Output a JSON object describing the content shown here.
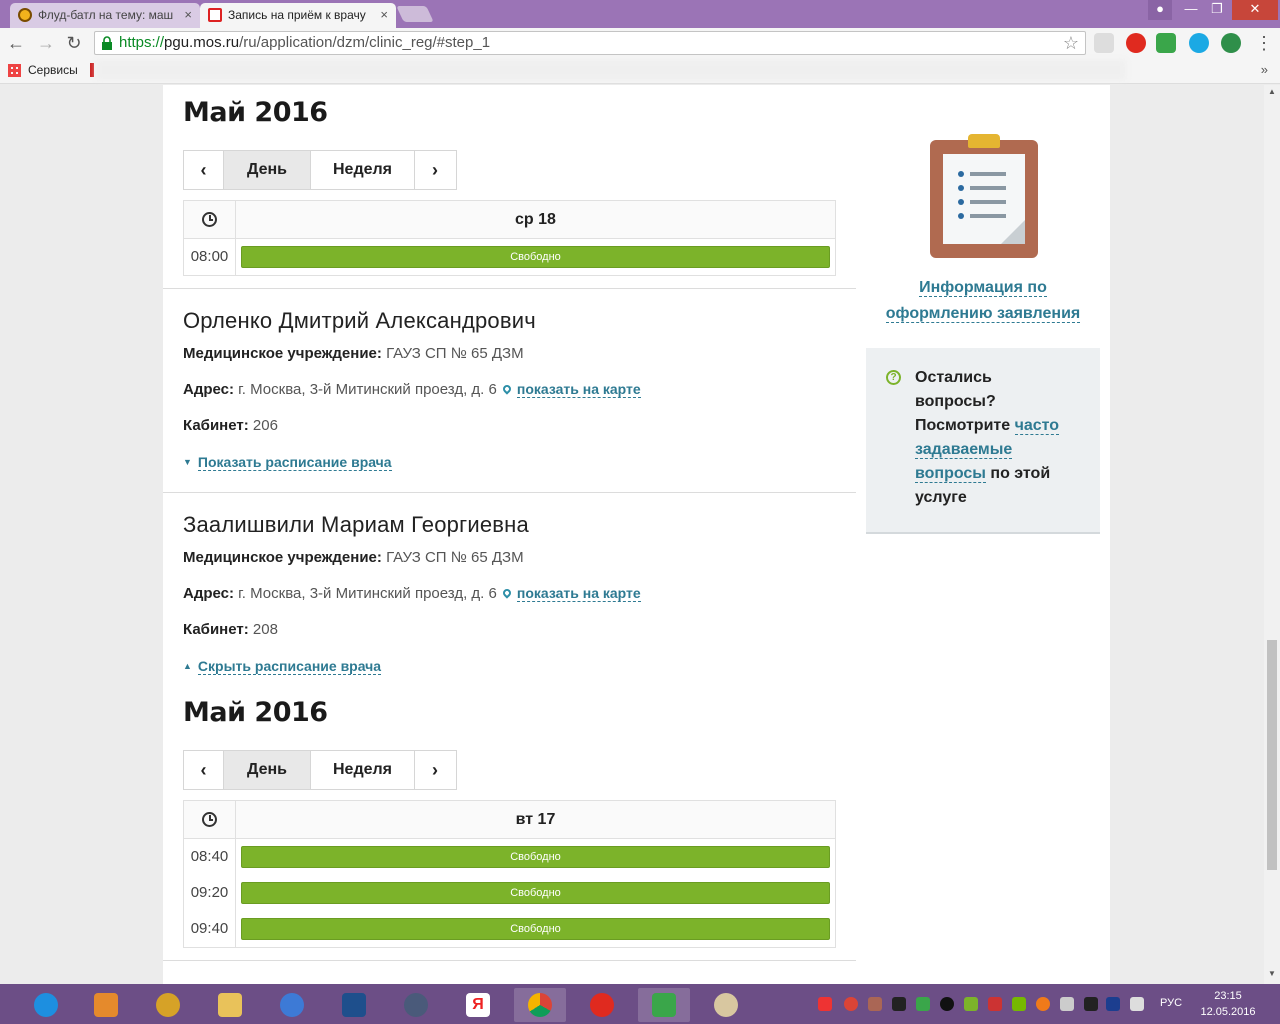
{
  "browser": {
    "tabs": [
      {
        "title": "Флуд-батл на тему: маш",
        "active": false
      },
      {
        "title": "Запись на приём к врачу",
        "active": true
      }
    ],
    "url_scheme": "https://",
    "url_host": "pgu.mos.ru",
    "url_path": "/ru/application/dzm/clinic_reg/#step_1",
    "bookmarks_label": "Сервисы",
    "bookmarks_more": "»"
  },
  "schedule_top": {
    "month": "Май 2016",
    "view_day": "День",
    "view_week": "Неделя",
    "day_header": "ср 18",
    "slots": [
      {
        "time": "08:00",
        "status": "Свободно"
      }
    ]
  },
  "doctors": [
    {
      "name": "Орленко Дмитрий Александрович",
      "institution_label": "Медицинское учреждение:",
      "institution": "ГАУЗ СП № 65 ДЗМ",
      "address_label": "Адрес:",
      "address": "г. Москва, 3-й Митинский проезд, д. 6",
      "map_link": "показать на карте",
      "room_label": "Кабинет:",
      "room": "206",
      "toggle_label": "Показать расписание врача"
    },
    {
      "name": "Заалишвили Мариам Георгиевна",
      "institution_label": "Медицинское учреждение:",
      "institution": "ГАУЗ СП № 65 ДЗМ",
      "address_label": "Адрес:",
      "address": "г. Москва, 3-й Митинский проезд, д. 6",
      "map_link": "показать на карте",
      "room_label": "Кабинет:",
      "room": "208",
      "toggle_label": "Скрыть расписание врача"
    }
  ],
  "schedule_bottom": {
    "month": "Май 2016",
    "view_day": "День",
    "view_week": "Неделя",
    "day_header": "вт 17",
    "slots": [
      {
        "time": "08:40",
        "status": "Свободно"
      },
      {
        "time": "09:20",
        "status": "Свободно"
      },
      {
        "time": "09:40",
        "status": "Свободно"
      }
    ]
  },
  "sidebar": {
    "info_link_line1": "Информация по",
    "info_link_line2": "оформлению заявления",
    "faq_line1": "Остались",
    "faq_line2": "вопросы?",
    "faq_line3": "Посмотрите ",
    "faq_link1": "часто",
    "faq_link2": "задаваемые",
    "faq_link3": "вопросы",
    "faq_tail": " по этой",
    "faq_end": "услуге"
  },
  "taskbar": {
    "lang": "РУС",
    "time": "23:15",
    "date": "12.05.2016"
  },
  "colors": {
    "slot_free": "#7cb32a",
    "link": "#2e7a92",
    "titlebar": "#9b74b6",
    "taskbar": "#6c4e86"
  }
}
